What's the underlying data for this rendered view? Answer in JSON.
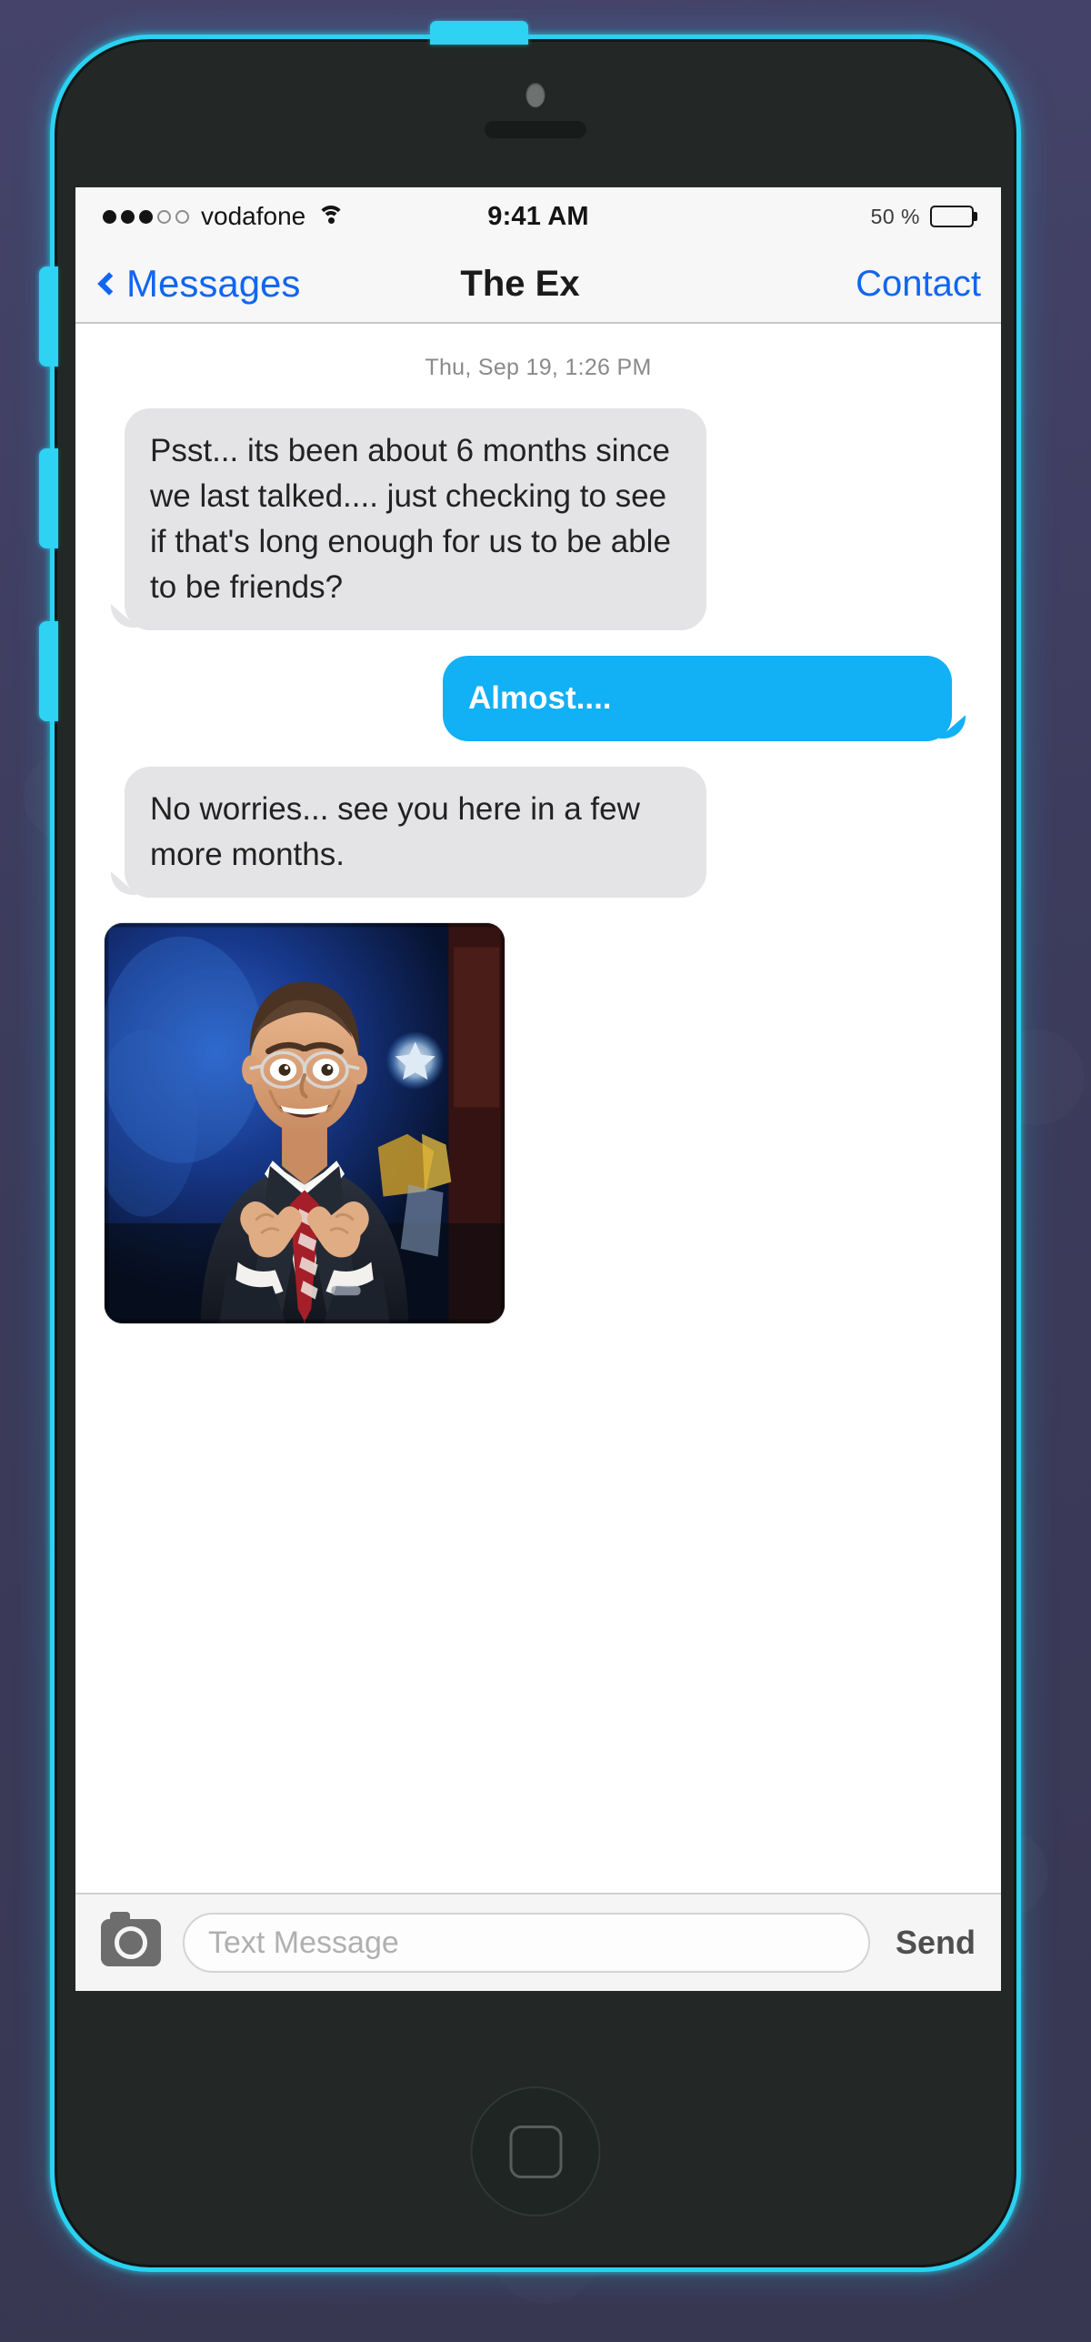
{
  "wallpaper": {
    "color": "#3e3d5e"
  },
  "device": {
    "name": "iPhone 5c",
    "body_color": "#232826",
    "accent_color": "#2ad2f2",
    "buttons": {
      "power": "power-button",
      "mute": "mute-switch",
      "volume_up": "volume-up",
      "volume_down": "volume-down",
      "home": "home-button"
    }
  },
  "status_bar": {
    "signal_dots_filled": 3,
    "signal_dots_total": 5,
    "carrier": "vodafone",
    "wifi": "wifi-icon",
    "time": "9:41 AM",
    "battery_percent_label": "50 %",
    "battery_level": 50
  },
  "nav_bar": {
    "back_label": "Messages",
    "title": "The Ex",
    "right_action": "Contact",
    "link_color": "#1066f0"
  },
  "conversation": {
    "date_divider": "Thu, Sep 19, 1:26 PM",
    "bubble_colors": {
      "incoming": "#e4e4e6",
      "outgoing": "#12b0f5"
    },
    "messages": [
      {
        "direction": "incoming",
        "text": "Psst... its been about 6 months since we last talked.... just checking to see if that's long enough for us to be able to be friends?"
      },
      {
        "direction": "outgoing",
        "text": "Almost...."
      },
      {
        "direction": "incoming",
        "text": "No worries... see you here in a few more months."
      }
    ],
    "attachment": {
      "type": "image",
      "description": "Animated GIF of a man in a dark suit, glasses and red striped tie on a blue-lit television set, grinning and gesturing excitedly with both hands"
    }
  },
  "input_bar": {
    "camera_icon": "camera-icon",
    "placeholder": "Text Message",
    "value": "",
    "send_label": "Send"
  }
}
